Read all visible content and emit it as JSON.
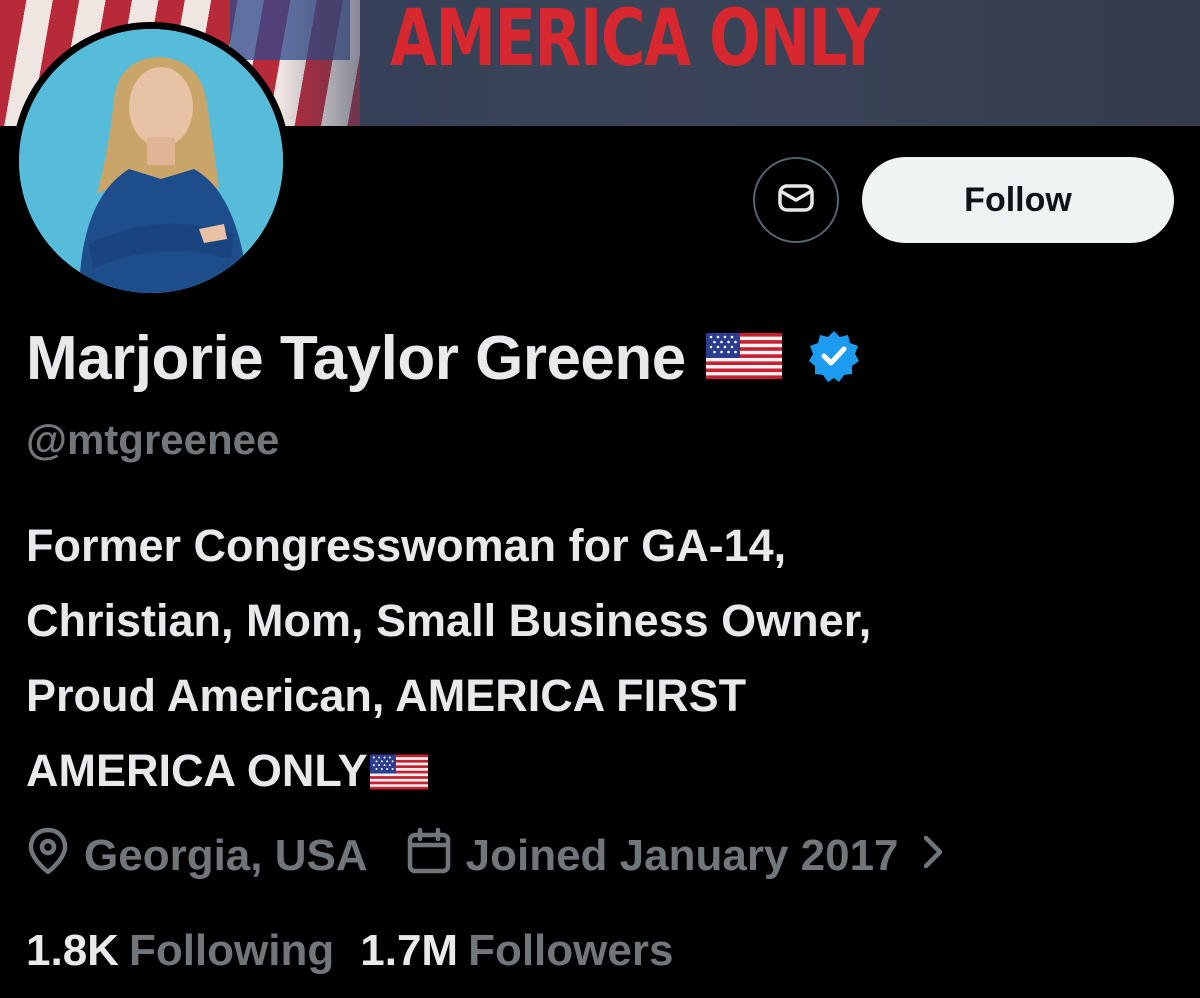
{
  "banner": {
    "text": "AMERICA ONLY"
  },
  "profile": {
    "name": "Marjorie Taylor Greene",
    "handle": "@mtgreenee",
    "bio_lines": [
      "Former Congresswoman for GA-14,",
      "Christian, Mom, Small Business Owner,",
      "Proud American, AMERICA FIRST",
      "AMERICA ONLY"
    ],
    "location": "Georgia, USA",
    "joined": "Joined January 2017",
    "following_count": "1.8K",
    "following_label": "Following",
    "followers_count": "1.7M",
    "followers_label": "Followers"
  },
  "actions": {
    "follow_label": "Follow"
  },
  "icons": {
    "message": "envelope-icon",
    "verified": "verified-badge-icon",
    "location": "map-pin-icon",
    "calendar": "calendar-icon",
    "chevron": "chevron-right-icon",
    "flag": "us-flag-emoji"
  },
  "colors": {
    "background": "#000000",
    "primary_text": "#e7e9ea",
    "secondary_text": "#71767b",
    "verified_blue": "#1d9bf0",
    "banner_text": "#d7282f",
    "follow_button_bg": "#eff3f4"
  }
}
